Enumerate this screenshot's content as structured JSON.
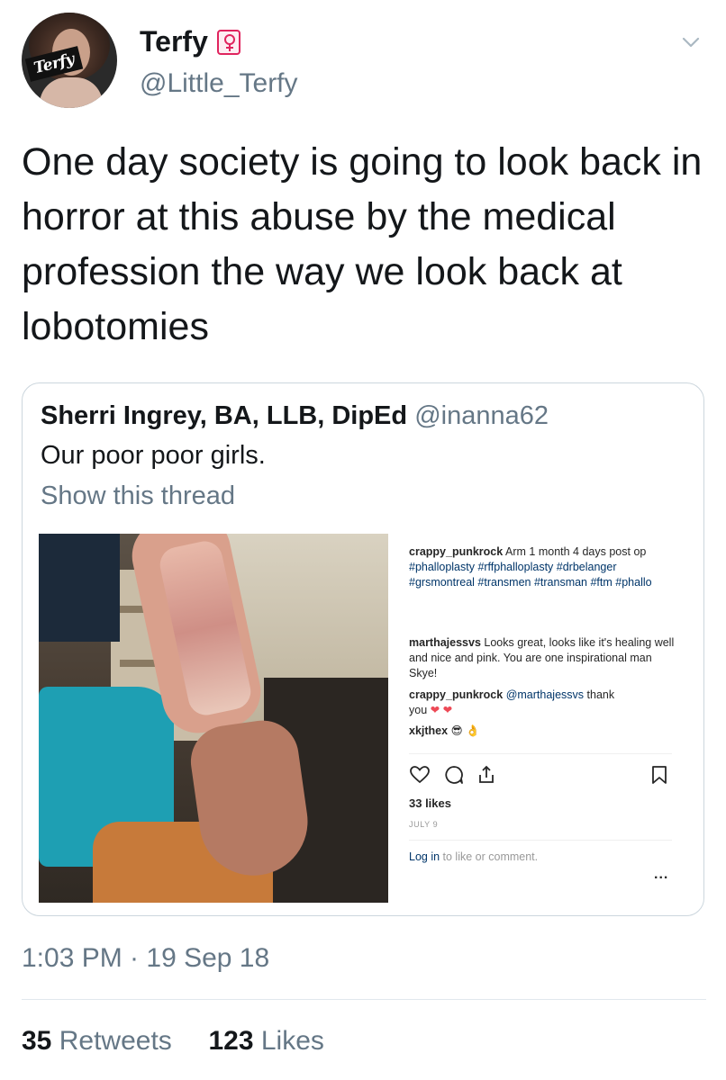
{
  "author": {
    "avatar_text": "Terfy",
    "display_name": "Terfy",
    "name_emoji": "female-sign-icon",
    "handle": "@Little_Terfy"
  },
  "tweet": {
    "text": "One day society is going to look back in horror at this abuse by the medical profession the way we look back at lobotomies",
    "timestamp": "1:03 PM · 19 Sep 18"
  },
  "quoted_tweet": {
    "name": "Sherri Ingrey, BA, LLB, DipEd",
    "handle": "@inanna62",
    "text": "Our poor poor girls.",
    "show_thread": "Show this thread",
    "instagram": {
      "comments": [
        {
          "user": "crappy_punkrock",
          "text": "Arm 1 month 4 days post op",
          "tags": "#phalloplasty #rffphalloplasty #drbelanger #grsmontreal #transmen #transman #ftm #phallo"
        },
        {
          "user": "marthajessvs",
          "text": "Looks great, looks like it's healing well and nice and pink. You are one inspirational man Skye!"
        },
        {
          "user": "crappy_punkrock",
          "mention": "@marthajessvs",
          "text": "thank",
          "text2": "you",
          "hearts": "❤ ❤"
        },
        {
          "user": "xkjthex",
          "emoji": "😎 👌"
        }
      ],
      "likes": "33 likes",
      "date": "JULY 9",
      "login_link": "Log in",
      "login_text": " to like or comment.",
      "more": "..."
    }
  },
  "stats": {
    "retweets_count": "35",
    "retweets_label": "Retweets",
    "likes_count": "123",
    "likes_label": "Likes"
  },
  "colors": {
    "text": "#14171a",
    "secondary": "#657786",
    "border": "#ccd6dd",
    "instagram_link": "#003569",
    "heart": "#ed4956"
  }
}
